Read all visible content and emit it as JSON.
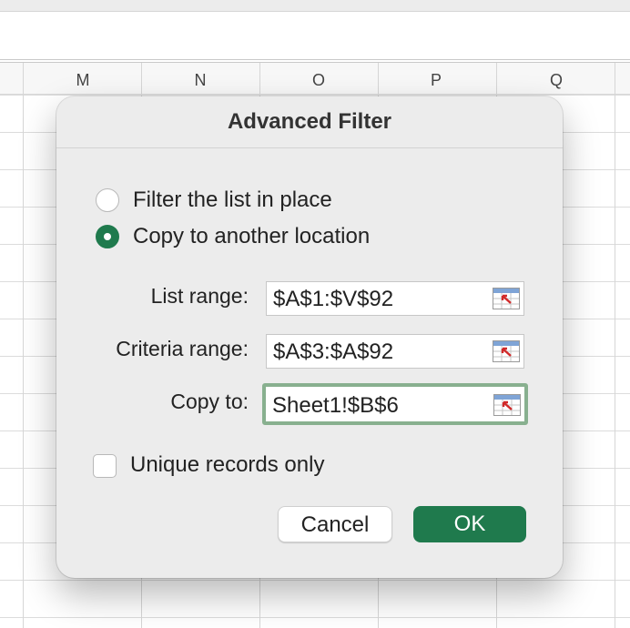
{
  "spreadsheet": {
    "columns": [
      "M",
      "N",
      "O",
      "P",
      "Q"
    ]
  },
  "dialog": {
    "title": "Advanced Filter",
    "action_options": [
      {
        "label": "Filter the list in place",
        "selected": false
      },
      {
        "label": "Copy to another location",
        "selected": true
      }
    ],
    "fields": {
      "list_range": {
        "label": "List range:",
        "value": "$A$1:$V$92"
      },
      "criteria_range": {
        "label": "Criteria range:",
        "value": "$A$3:$A$92"
      },
      "copy_to": {
        "label": "Copy to:",
        "value": "Sheet1!$B$6"
      }
    },
    "unique_records": {
      "label": "Unique records only",
      "checked": false
    },
    "buttons": {
      "cancel": "Cancel",
      "ok": "OK"
    },
    "accent_color": "#1f7a4d"
  }
}
